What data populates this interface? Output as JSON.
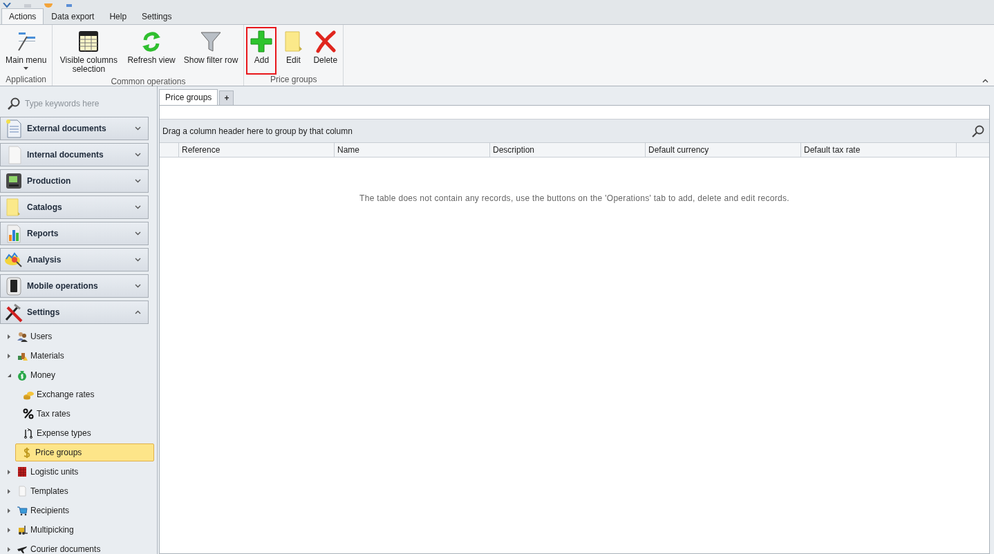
{
  "ribbon": {
    "tabs": [
      {
        "label": "Actions",
        "selected": true
      },
      {
        "label": "Data export",
        "selected": false
      },
      {
        "label": "Help",
        "selected": false
      },
      {
        "label": "Settings",
        "selected": false
      }
    ],
    "groups": [
      {
        "caption": "Application",
        "buttons": [
          {
            "label": "Main menu",
            "dropdown": true,
            "highlighted": false
          }
        ]
      },
      {
        "caption": "Common operations",
        "buttons": [
          {
            "label": "Visible columns selection",
            "dropdown": false,
            "highlighted": false
          },
          {
            "label": "Refresh view",
            "dropdown": false,
            "highlighted": false
          },
          {
            "label": "Show filter row",
            "dropdown": false,
            "highlighted": false
          }
        ]
      },
      {
        "caption": "Price groups",
        "buttons": [
          {
            "label": "Add",
            "dropdown": false,
            "highlighted": true
          },
          {
            "label": "Edit",
            "dropdown": false,
            "highlighted": false
          },
          {
            "label": "Delete",
            "dropdown": false,
            "highlighted": false
          }
        ]
      }
    ]
  },
  "sidebar": {
    "search": {
      "placeholder": "Type keywords here"
    },
    "sections": [
      {
        "label": "External documents",
        "expanded": false
      },
      {
        "label": "Internal documents",
        "expanded": false
      },
      {
        "label": "Production",
        "expanded": false
      },
      {
        "label": "Catalogs",
        "expanded": false
      },
      {
        "label": "Reports",
        "expanded": false
      },
      {
        "label": "Analysis",
        "expanded": false
      },
      {
        "label": "Mobile operations",
        "expanded": false
      },
      {
        "label": "Settings",
        "expanded": true,
        "items": [
          {
            "label": "Users",
            "expanded": false,
            "selected": false
          },
          {
            "label": "Materials",
            "expanded": false,
            "selected": false
          },
          {
            "label": "Money",
            "expanded": true,
            "selected": false,
            "children": [
              {
                "label": "Exchange rates",
                "selected": false
              },
              {
                "label": "Tax rates",
                "selected": false
              },
              {
                "label": "Expense types",
                "selected": false
              },
              {
                "label": "Price groups",
                "selected": true
              }
            ]
          },
          {
            "label": "Logistic units",
            "expanded": false,
            "selected": false
          },
          {
            "label": "Templates",
            "expanded": false,
            "selected": false
          },
          {
            "label": "Recipients",
            "expanded": false,
            "selected": false
          },
          {
            "label": "Multipicking",
            "expanded": false,
            "selected": false
          },
          {
            "label": "Courier documents",
            "expanded": false,
            "selected": false
          }
        ]
      }
    ]
  },
  "document_tabs": {
    "tabs": [
      {
        "label": "Price groups",
        "selected": true
      }
    ],
    "add_tab": "+"
  },
  "grid": {
    "group_panel": "Drag a column header here to group by that column",
    "columns": [
      "Reference",
      "Name",
      "Description",
      "Default currency",
      "Default tax rate"
    ],
    "empty_message": "The table does not contain any records, use the buttons on the 'Operations' tab to add, delete and edit records."
  }
}
